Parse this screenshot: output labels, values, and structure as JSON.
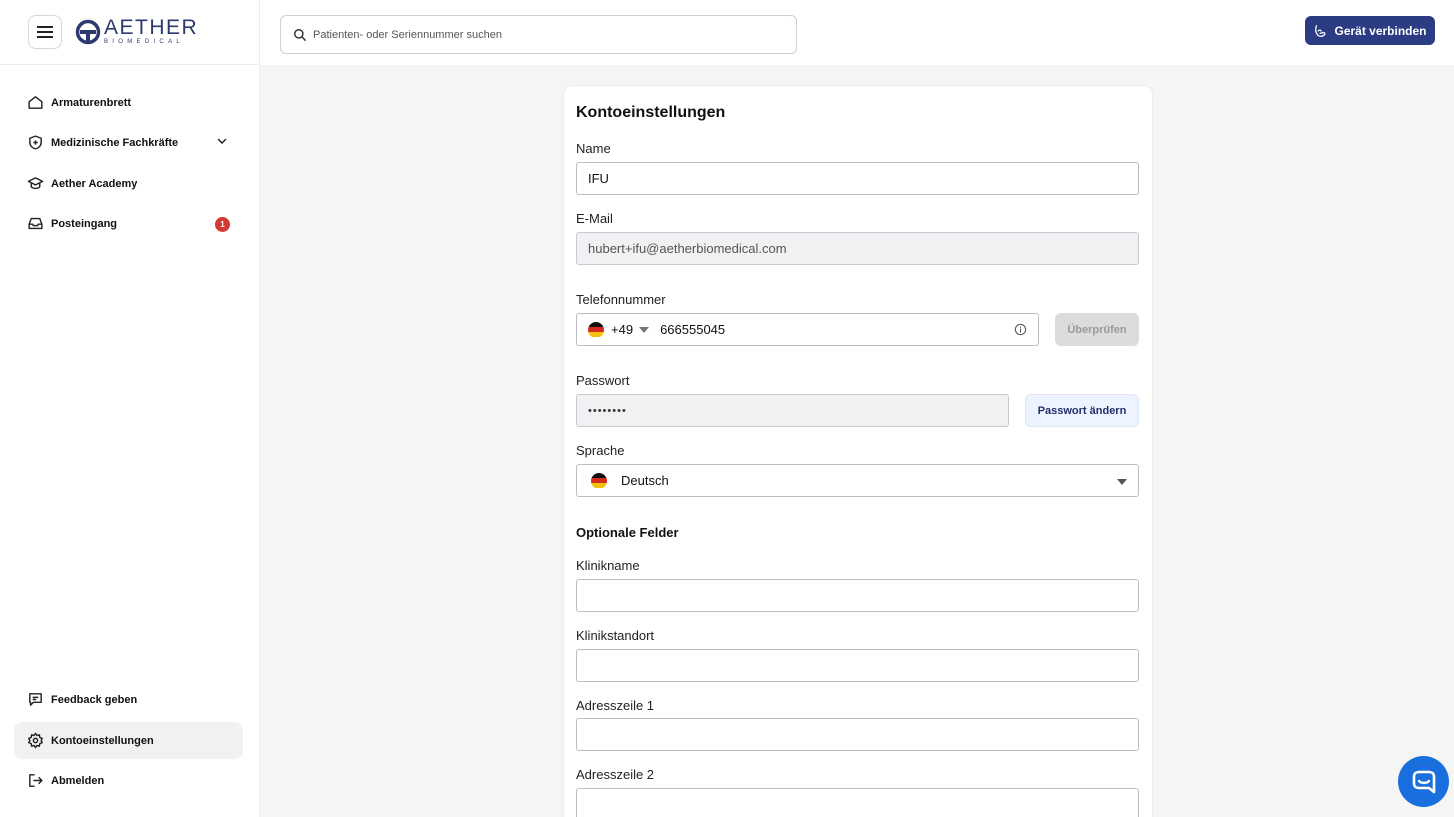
{
  "brand": {
    "name": "AETHER",
    "sub": "BIOMEDICAL",
    "color": "#2c3a70"
  },
  "sidebar": {
    "items": [
      {
        "label": "Armaturenbrett",
        "icon": "home-icon"
      },
      {
        "label": "Medizinische Fachkräfte",
        "icon": "shield-plus-icon",
        "expandable": true
      },
      {
        "label": "Aether Academy",
        "icon": "graduation-cap-icon"
      },
      {
        "label": "Posteingang",
        "icon": "inbox-icon",
        "badge": "1"
      }
    ],
    "bottom_items": [
      {
        "label": "Feedback geben",
        "icon": "message-icon"
      },
      {
        "label": "Kontoeinstellungen",
        "icon": "gear-icon",
        "active": true
      },
      {
        "label": "Abmelden",
        "icon": "logout-icon"
      }
    ]
  },
  "search": {
    "placeholder": "Patienten- oder Seriennummer suchen"
  },
  "header": {
    "connect_label": "Gerät verbinden",
    "accent": "#2b3b84"
  },
  "form": {
    "title": "Kontoeinstellungen",
    "name_label": "Name",
    "name_value": "IFU",
    "email_label": "E-Mail",
    "email_value": "hubert+ifu@aetherbiomedical.com",
    "phone_label": "Telefonnummer",
    "phone_code": "+49",
    "phone_value": "666555045",
    "verify_label": "Überprüfen",
    "password_label": "Passwort",
    "password_value": "••••••••",
    "change_password_label": "Passwort ändern",
    "language_label": "Sprache",
    "language_value": "Deutsch",
    "optional_title": "Optionale Felder",
    "clinic_name_label": "Klinikname",
    "clinic_location_label": "Klinikstandort",
    "address1_label": "Adresszeile 1",
    "address2_label": "Adresszeile 2"
  }
}
